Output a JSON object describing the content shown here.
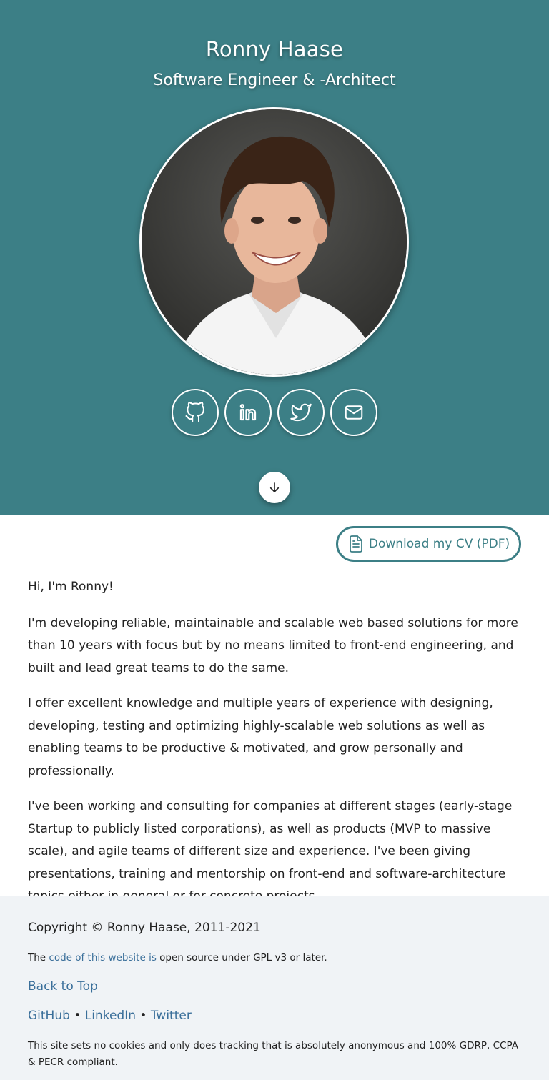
{
  "hero": {
    "name": "Ronny Haase",
    "role": "Software Engineer & -Architect",
    "avatar_alt": "Ronny Haase",
    "background_color": "#3c7f86",
    "socials": [
      {
        "icon": "github-icon",
        "name": "GitHub"
      },
      {
        "icon": "linkedin-icon",
        "name": "LinkedIn"
      },
      {
        "icon": "twitter-icon",
        "name": "Twitter"
      },
      {
        "icon": "mail-icon",
        "name": "Email"
      }
    ],
    "scroll_icon": "arrow-down-icon"
  },
  "main": {
    "cv_button": "Download my CV (PDF)",
    "cv_icon": "document-icon",
    "greeting": "Hi, I'm Ronny!",
    "paragraphs": [
      "I'm developing reliable, maintainable and scalable web based solutions for more than 10 years with focus but by no means limited to front-end engineering, and built and lead great teams to do the same.",
      "I offer excellent knowledge and multiple years of experience with designing, developing, testing and optimizing highly-scalable web solutions as well as enabling teams to be productive & motivated, and grow personally and professionally.",
      "I've been working and consulting for companies at different stages (early-stage Startup to publicly listed corporations), as well as products (MVP to massive scale), and agile teams of different size and experience. I've been giving presentations, training and mentorship on front-end and software-architecture topics either in general or for concrete projects."
    ]
  },
  "footer": {
    "copyright": "Copyright © Ronny Haase, 2011-2021",
    "gpl_prefix": "The ",
    "gpl_link": "code of this website is",
    "gpl_suffix": " open source under GPL v3 or later.",
    "back_to_top": "Back to Top",
    "links": [
      "GitHub",
      "LinkedIn",
      "Twitter"
    ],
    "separator": " • ",
    "note": "This site sets no cookies and only does tracking that is absolutely anonymous and 100% GDRP, CCPA & PECR compliant."
  }
}
